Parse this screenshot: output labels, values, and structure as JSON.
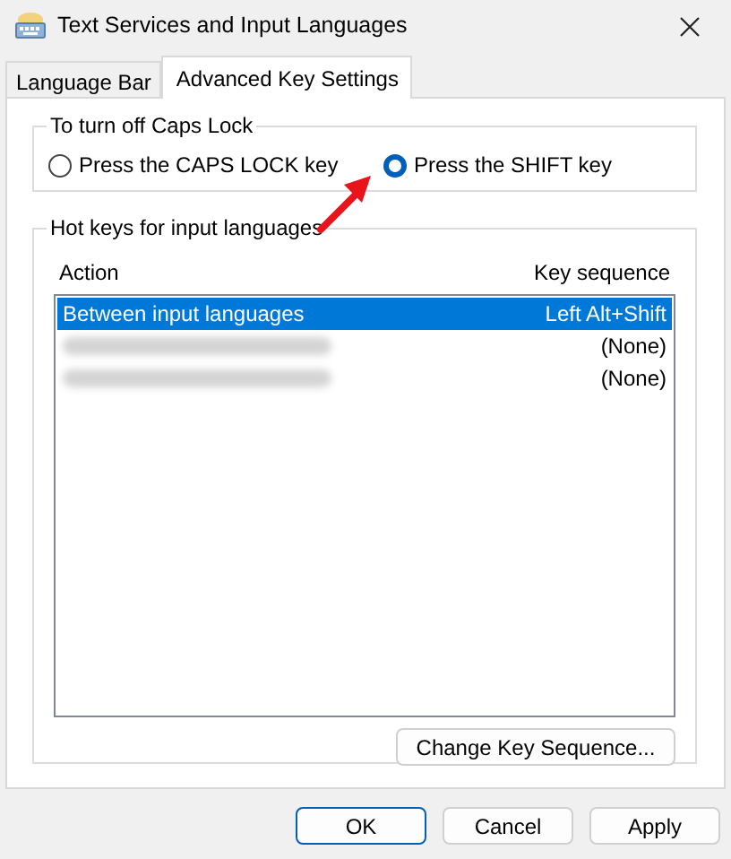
{
  "window": {
    "title": "Text Services and Input Languages"
  },
  "tabs": [
    {
      "label": "Language Bar",
      "selected": false
    },
    {
      "label": "Advanced Key Settings",
      "selected": true
    }
  ],
  "caps_lock_group": {
    "title": "To turn off Caps Lock",
    "options": [
      {
        "label": "Press the CAPS LOCK key",
        "selected": false
      },
      {
        "label": "Press the SHIFT key",
        "selected": true
      }
    ]
  },
  "hotkeys_group": {
    "title": "Hot keys for input languages",
    "columns": [
      "Action",
      "Key sequence"
    ],
    "rows": [
      {
        "action": "Between input languages",
        "key_sequence": "Left Alt+Shift",
        "selected": true,
        "blurred": false
      },
      {
        "key_sequence": "(None)",
        "selected": false,
        "blurred": true
      },
      {
        "key_sequence": "(None)",
        "selected": false,
        "blurred": true
      }
    ],
    "button": "Change Key Sequence..."
  },
  "buttons": [
    {
      "label": "OK",
      "default": true
    },
    {
      "label": "Cancel",
      "default": false
    },
    {
      "label": "Apply",
      "default": false
    }
  ]
}
